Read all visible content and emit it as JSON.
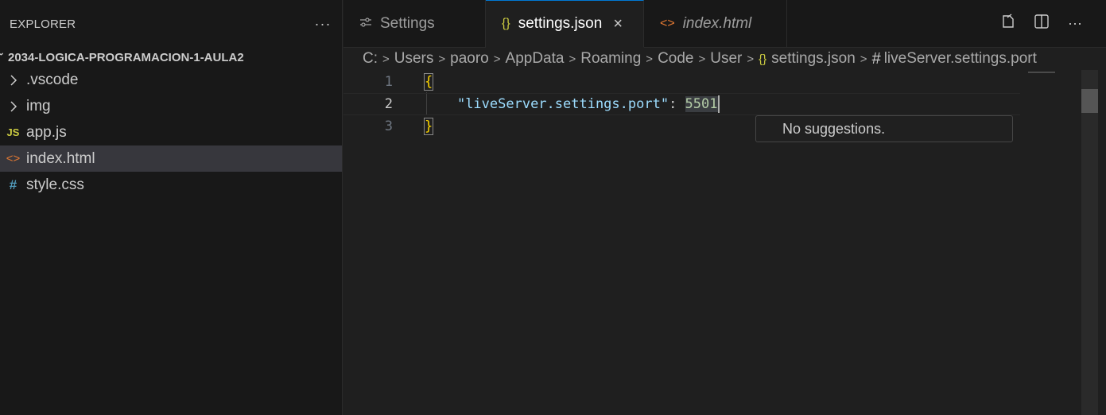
{
  "explorer": {
    "title": "EXPLORER",
    "more_icon": "ellipsis-icon",
    "folder": "2034-LOGICA-PROGRAMACION-1-AULA2",
    "items": [
      {
        "label": ".vscode",
        "icon": "chevron-right-icon",
        "type": "folder"
      },
      {
        "label": "img",
        "icon": "chevron-right-icon",
        "type": "folder"
      },
      {
        "label": "app.js",
        "icon_text": "JS",
        "type": "file"
      },
      {
        "label": "index.html",
        "icon_text": "<>",
        "type": "file",
        "selected": true
      },
      {
        "label": "style.css",
        "icon_text": "#",
        "type": "file"
      }
    ]
  },
  "tabs": [
    {
      "label": "Settings",
      "icon": "settings-sliders-icon"
    },
    {
      "label": "settings.json",
      "icon_text": "{}",
      "active": true,
      "close": "×"
    },
    {
      "label": "index.html",
      "icon_text": "<>",
      "italic": true
    }
  ],
  "tab_actions": [
    "open-preview-icon",
    "split-editor-icon",
    "more-actions-icon"
  ],
  "breadcrumb": [
    "C:",
    "Users",
    "paoro",
    "AppData",
    "Roaming",
    "Code",
    "User",
    "settings.json",
    "liveServer.settings.port"
  ],
  "editor": {
    "line_numbers": [
      "1",
      "2",
      "3"
    ],
    "open_brace": "{",
    "close_brace": "}",
    "key": "\"liveServer.settings.port\"",
    "colon": ": ",
    "value": "5501",
    "suggestion": "No suggestions."
  },
  "colors": {
    "accent": "#0078d4",
    "brace": "#ffd700",
    "key": "#9cdcfe",
    "number": "#b5cea8"
  }
}
